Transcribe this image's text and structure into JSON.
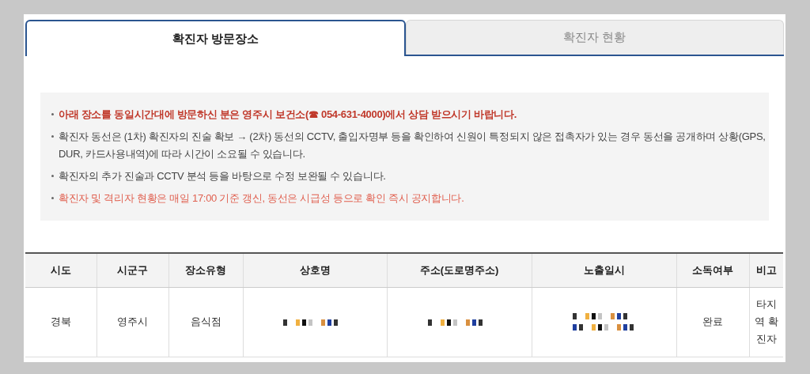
{
  "tabs": [
    {
      "label": "확진자 방문장소",
      "selected": true
    },
    {
      "label": "확진자 현황",
      "selected": false
    }
  ],
  "notices": [
    {
      "kind": "alert",
      "text": "아래 장소를 동일시간대에 방문하신 분은 영주시 보건소(☎ 054-631-4000)에서 상담 받으시기 바랍니다."
    },
    {
      "kind": "plain",
      "text": "확진자 동선은 (1차) 확진자의 진술 확보 → (2차) 동선의 CCTV, 출입자명부 등을 확인하여 신원이 특정되지 않은 접촉자가 있는 경우 동선을 공개하며 상황(GPS, DUR, 카드사용내역)에 따라 시간이 소요될 수 있습니다."
    },
    {
      "kind": "plain",
      "text": "확진자의 추가 진술과 CCTV 분석 등을 바탕으로 수정 보완될 수 있습니다."
    },
    {
      "kind": "note",
      "text": "확진자 및 격리자 현황은 매일 17:00 기준 갱신, 동선은 시급성 등으로 확인 즉시 공지합니다."
    }
  ],
  "table": {
    "columns": [
      "시도",
      "시군구",
      "장소유형",
      "상호명",
      "주소(도로명주소)",
      "노출일시",
      "소독여부",
      "비고"
    ],
    "rows": [
      {
        "cells": [
          {
            "kind": "text",
            "text": "경북"
          },
          {
            "kind": "text",
            "text": "영주시"
          },
          {
            "kind": "text",
            "text": "음식점"
          },
          {
            "kind": "mosaic"
          },
          {
            "kind": "mosaic"
          },
          {
            "kind": "mosaic2"
          },
          {
            "kind": "text",
            "text": "완료"
          },
          {
            "kind": "text",
            "text": "타지역 확진자"
          }
        ]
      }
    ]
  }
}
